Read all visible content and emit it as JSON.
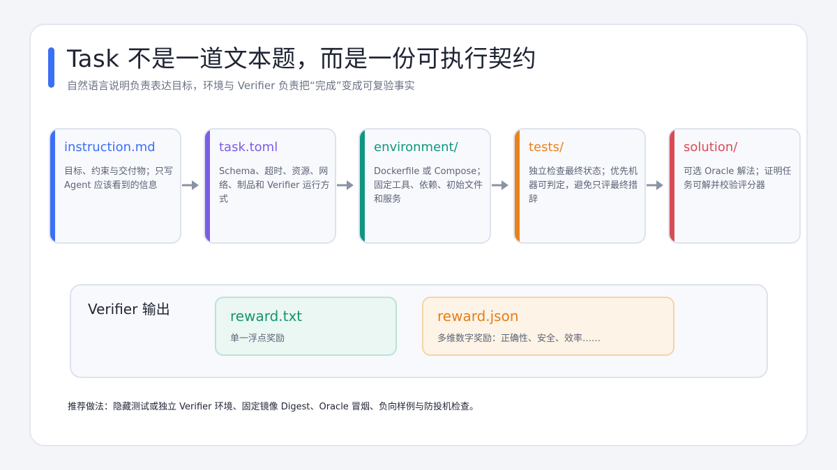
{
  "header": {
    "title": "Task 不是一道文本题，而是一份可执行契约",
    "subtitle": "自然语言说明负责表达目标，环境与 Verifier 负责把“完成”变成可复验事实"
  },
  "stages": [
    {
      "name": "instruction.md",
      "desc": "目标、约束与交付物；只写 Agent 应该看到的信息",
      "color": "#3b6ff5"
    },
    {
      "name": "task.toml",
      "desc": "Schema、超时、资源、网络、制品和 Verifier 运行方式",
      "color": "#7c5ce6"
    },
    {
      "name": "environment/",
      "desc": "Dockerfile 或 Compose；固定工具、依赖、初始文件和服务",
      "color": "#0f9680"
    },
    {
      "name": "tests/",
      "desc": "独立检查最终状态；优先机器可判定，避免只评最终措辞",
      "color": "#e8821e"
    },
    {
      "name": "solution/",
      "desc": "可选 Oracle 解法；证明任务可解并校验评分器",
      "color": "#d84b55"
    }
  ],
  "arrow_icon": "arrow-right-icon",
  "verifier": {
    "title": "Verifier 输出",
    "outputs": [
      {
        "name": "reward.txt",
        "desc": "单一浮点奖励",
        "color": "#18946f",
        "bg": "#eaf7f3",
        "border": "#b9e3d6"
      },
      {
        "name": "reward.json",
        "desc": "多维数字奖励：正确性、安全、效率……",
        "color": "#e37e1b",
        "bg": "#fdf3e6",
        "border": "#f4d3a8"
      }
    ]
  },
  "note": "推荐做法：隐藏测试或独立 Verifier 环境、固定镜像 Digest、Oracle 冒烟、负向样例与防投机检查。"
}
